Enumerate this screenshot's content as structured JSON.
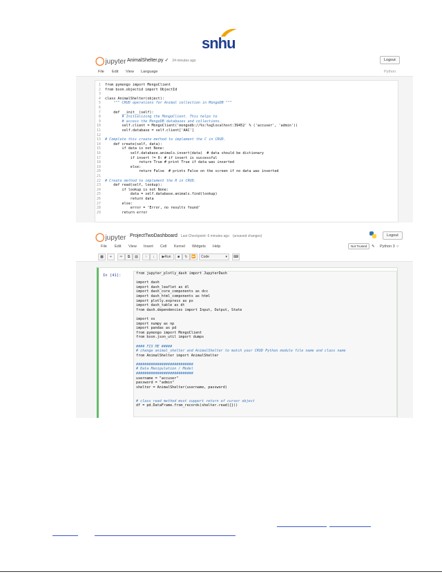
{
  "logo": {
    "text": "snhu"
  },
  "shot1": {
    "app": "jupyter",
    "title": "AnimalShelter.py",
    "saved": "24 minutes ago",
    "logout": "Logout",
    "menu": [
      "File",
      "Edit",
      "View",
      "Language"
    ],
    "lang": "Python",
    "lines": [
      "from pymongo import MongoClient",
      "from bson.objectid import ObjectId",
      "",
      "class AnimalShelter(object):",
      "    \"\"\" CRUD operations for Animal collection in MongoDB \"\"\"",
      "",
      "    def __init__(self):",
      "        # Initializing the MongoClient. This helps to",
      "        # access the MongoDB databases and collections.",
      "        self.client = MongoClient('mongodb://%s:%s@localhost:39452' % ('accuser', 'admin'))",
      "        self.database = self.client['AAC']",
      "",
      "# Complete this create method to implement the C in CRUD.",
      "    def create(self, data):",
      "        if data is not None:",
      "            self.database.animals.insert(data)  # data should be dictionary",
      "            if insert != 0: # if insert is successful",
      "                return True # print True if data was inserted",
      "            else:",
      "                return False  # prints False on the screen if no data was inserted",
      "",
      "# Create method to implement the R in CRUD.",
      "    def read(self, lookup):",
      "        if lookup is not None:",
      "            data = self.database.animals.find(lookup)",
      "            return data",
      "        else:",
      "            error = 'Error, no results found'",
      "        return error"
    ]
  },
  "shot2": {
    "app": "jupyter",
    "title": "ProjectTwoDashboard",
    "checkpoint": "Last Checkpoint: 6 minutes ago",
    "unsaved": "(unsaved changes)",
    "logout": "Logout",
    "menu": [
      "File",
      "Edit",
      "View",
      "Insert",
      "Cell",
      "Kernel",
      "Widgets",
      "Help"
    ],
    "trusted": "Not Trusted",
    "kernel": "Python 3",
    "run_label": "Run",
    "cell_type": "Code",
    "prompt": "In [41]:",
    "code": [
      "from jupyter_plotly_dash import JupyterDash",
      "",
      "import dash",
      "import dash_leaflet as dl",
      "import dash_core_components as dcc",
      "import dash_html_components as html",
      "import plotly.express as px",
      "import dash_table as dt",
      "from dash.dependencies import Input, Output, State",
      "",
      "import os",
      "import numpy as np",
      "import pandas as pd",
      "from pymongo import MongoClient",
      "from bson.json_util import dumps",
      "",
      "#### FIX ME #####",
      "# change animal_shelter and AnimalShelter to match your CRUD Python module file name and class name",
      "from AnimalShelter import AnimalShelter",
      "",
      "###########################",
      "# Data Manipulation / Model",
      "###########################",
      "username = \"accuser\"",
      "password = \"admin\"",
      "shelter = AnimalShelter(username, password)",
      "",
      "",
      "# class read method must support return of cursor object",
      "df = pd.DataFrame.from_records(shelter.read({}))"
    ]
  },
  "colors": {
    "jupyter_orange": "#f37726",
    "cell_green": "#66bb6a",
    "snhu_blue": "#1f3f8f",
    "link_blue": "#3a57c8"
  }
}
